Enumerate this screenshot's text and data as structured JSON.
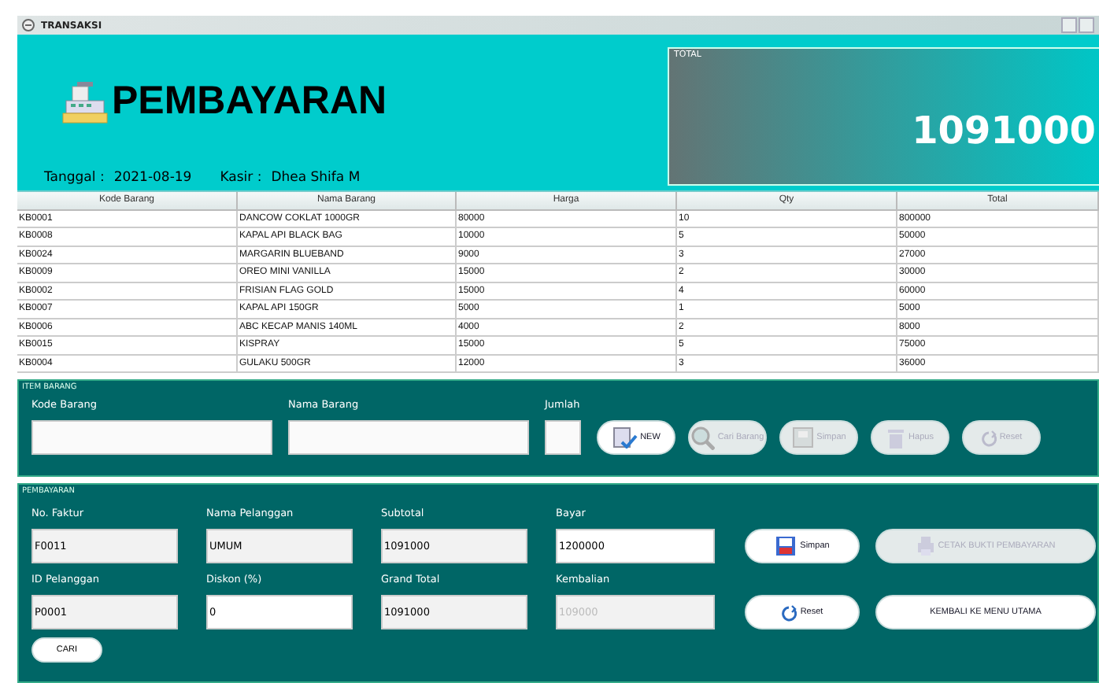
{
  "window": {
    "title": "TRANSAKSI"
  },
  "header": {
    "title": "PEMBAYARAN",
    "date_label": "Tanggal :",
    "date": "2021-08-19",
    "cashier_label": "Kasir :",
    "cashier": "Dhea Shifa M",
    "total_label": "TOTAL",
    "total": "1091000"
  },
  "table": {
    "columns": [
      "Kode Barang",
      "Nama Barang",
      "Harga",
      "Qty",
      "Total"
    ],
    "rows": [
      [
        "KB0001",
        "DANCOW COKLAT 1000GR",
        "80000",
        "10",
        "800000"
      ],
      [
        "KB0008",
        "KAPAL API BLACK BAG",
        "10000",
        "5",
        "50000"
      ],
      [
        "KB0024",
        "MARGARIN BLUEBAND",
        "9000",
        "3",
        "27000"
      ],
      [
        "KB0009",
        "OREO MINI VANILLA",
        "15000",
        "2",
        "30000"
      ],
      [
        "KB0002",
        "FRISIAN FLAG GOLD",
        "15000",
        "4",
        "60000"
      ],
      [
        "KB0007",
        "KAPAL API 150GR",
        "5000",
        "1",
        "5000"
      ],
      [
        "KB0006",
        "ABC KECAP MANIS 140ML",
        "4000",
        "2",
        "8000"
      ],
      [
        "KB0015",
        "KISPRAY",
        "15000",
        "5",
        "75000"
      ],
      [
        "KB0004",
        "GULAKU 500GR",
        "12000",
        "3",
        "36000"
      ]
    ]
  },
  "item_panel": {
    "title": "ITEM BARANG",
    "fields": [
      {
        "label": "Kode Barang"
      },
      {
        "label": "Nama Barang"
      },
      {
        "label": "Jumlah"
      }
    ],
    "buttons": [
      {
        "label": "NEW",
        "kind": "new",
        "disabled": false
      },
      {
        "label": "Cari Barang",
        "kind": "search",
        "disabled": true
      },
      {
        "label": "Simpan",
        "kind": "save",
        "disabled": true
      },
      {
        "label": "Hapus",
        "kind": "trash",
        "disabled": true
      },
      {
        "label": "Reset",
        "kind": "reset",
        "disabled": true
      }
    ]
  },
  "payment_panel": {
    "title": "PEMBAYARAN",
    "rows": [
      {
        "fields": [
          {
            "label": "No. Faktur",
            "value": "F0011",
            "editable": false,
            "disabled": false
          },
          {
            "label": "Nama Pelanggan",
            "value": "UMUM",
            "editable": false,
            "disabled": false
          },
          {
            "label": "Subtotal",
            "value": "1091000",
            "editable": false,
            "disabled": false
          },
          {
            "label": "Bayar",
            "value": "1200000",
            "editable": true,
            "disabled": false
          }
        ],
        "buttons": [
          {
            "label": "Simpan",
            "kind": "save",
            "disabled": false
          },
          {
            "label": "CETAK BUKTI PEMBAYARAN",
            "kind": "print",
            "disabled": true
          }
        ]
      },
      {
        "fields": [
          {
            "label": "ID Pelanggan",
            "value": "P0001",
            "editable": false,
            "disabled": false
          },
          {
            "label": "Diskon (%)",
            "value": "0",
            "editable": true,
            "disabled": false
          },
          {
            "label": "Grand Total",
            "value": "1091000",
            "editable": false,
            "disabled": false
          },
          {
            "label": "Kembalian",
            "value": "109000",
            "editable": false,
            "disabled": true
          }
        ],
        "buttons": [
          {
            "label": "Reset",
            "kind": "reset",
            "disabled": false
          },
          {
            "label": "KEMBALI KE MENU UTAMA",
            "kind": "text",
            "disabled": false
          }
        ]
      }
    ],
    "search_button": "CARI"
  }
}
